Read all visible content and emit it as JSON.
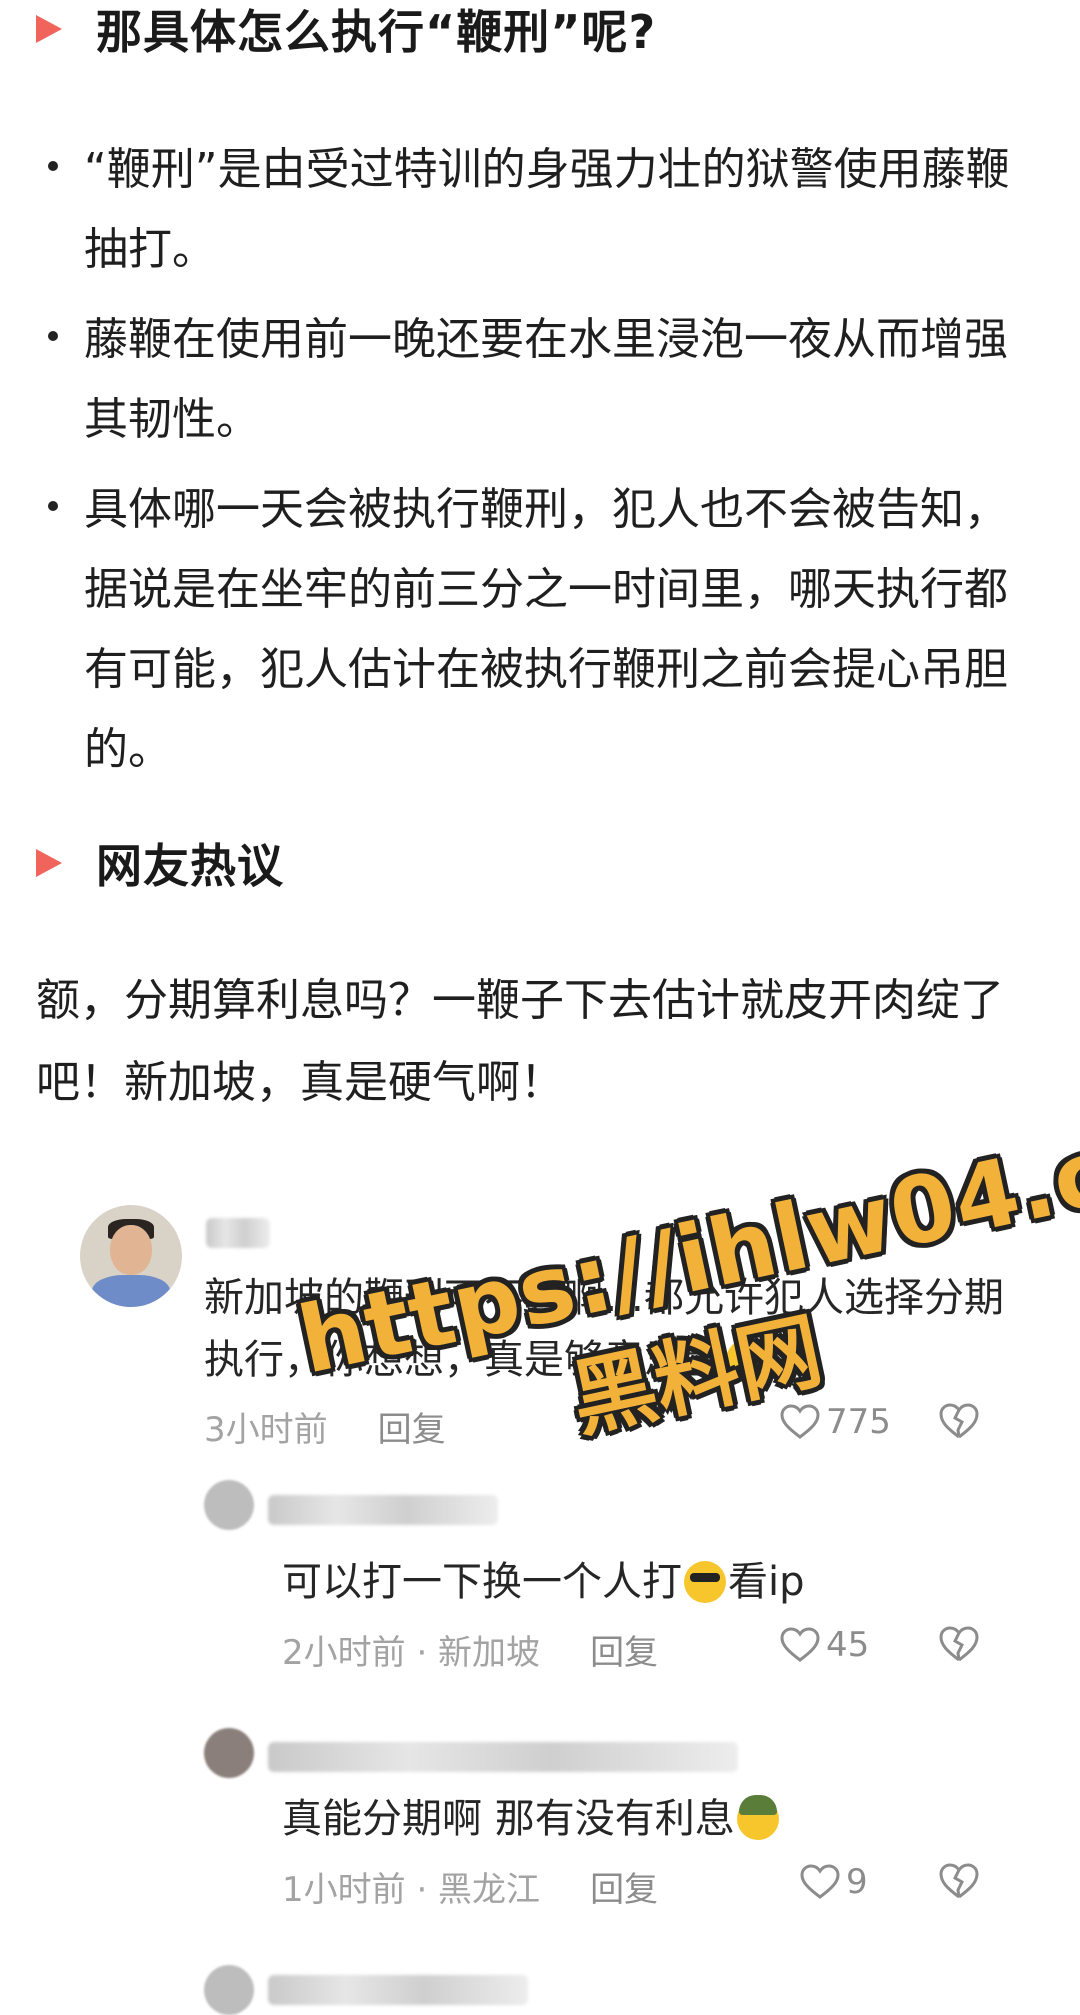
{
  "section1": {
    "heading": "那具体怎么执行“鞭刑”呢?"
  },
  "bullets": [
    "“鞭刑”是由受过特训的身强力壮的狱警使用藤鞭抽打。",
    "藤鞭在使用前一晚还要在水里浸泡一夜从而增强其韧性。",
    "具体哪一天会被执行鞭刑，犯人也不会被告知，据说是在坐牢的前三分之一时间里，哪天执行都有可能，犯人估计在被执行鞭刑之前会提心吊胆的。"
  ],
  "section2": {
    "heading": "网友热议"
  },
  "paragraph": "额，分期算利息吗？一鞭子下去估计就皮开肉绽了吧！新加坡，真是硬气啊！",
  "comments": [
    {
      "text": "新加坡的鞭刑可不轻啊…都允许犯人选择分期执行，你想想，真是够意思量",
      "time": "3小时前",
      "reply": "回复",
      "likes": "775",
      "avatar_icon": "avatar-photo",
      "emoji": "grinning-face"
    },
    {
      "text": "可以打一下换一个人打",
      "text_after": "看ip",
      "time": "2小时前 · 新加坡",
      "reply": "回复",
      "likes": "45",
      "emoji": "sunglasses-face"
    },
    {
      "text": "真能分期啊 那有没有利息",
      "time": "1小时前 · 黑龙江",
      "reply": "回复",
      "likes": "9",
      "emoji": "helmet-face"
    }
  ],
  "watermark": {
    "line1": "https://ihlw04.com",
    "line2": "黑料网"
  },
  "colors": {
    "accent": "#f0645c",
    "watermark": "#f2b23a",
    "meta": "#a3a3a3"
  }
}
